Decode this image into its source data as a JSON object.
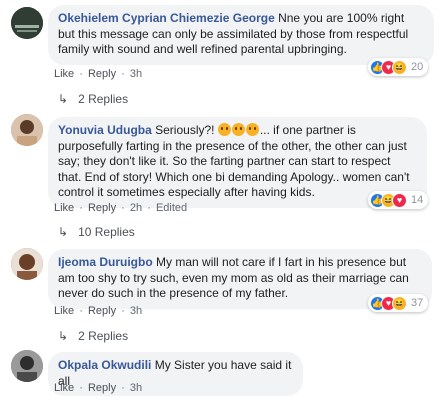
{
  "comments": [
    {
      "author": "Okehielem Cyprian Chiemezie George",
      "text": "Nne you are 100% right but this message can only be assimilated by those from respectful family with sound and well refined parental upbringing.",
      "like": "Like",
      "reply": "Reply",
      "time": "3h",
      "edited": "",
      "reaction_count": "20",
      "replies_label": "2 Replies",
      "avatar_color": "#3a4a3f"
    },
    {
      "author": "Yonuvia Udugba",
      "text_before": "Seriously?!",
      "text_after": "... if one partner is purposefully farting in the presence of the other, the other can just say; they don't like it. So the farting partner can start to respect that. End of story! Which one bi demanding Apology.. women can't control it sometimes especially after having kids.",
      "emoji_names": [
        "worried-face-icon",
        "worried-face-icon",
        "worried-face-icon"
      ],
      "like": "Like",
      "reply": "Reply",
      "time": "2h",
      "edited": "Edited",
      "reaction_count": "14",
      "replies_label": "10 Replies",
      "avatar_color": "#b58e6e"
    },
    {
      "author": "Ijeoma Duruigbo",
      "text": "My man will not care if I fart in his presence but am too shy to try such, even my mom as old as their marriage can never do such in the presence of my father.",
      "like": "Like",
      "reply": "Reply",
      "time": "3h",
      "edited": "",
      "reaction_count": "37",
      "replies_label": "2 Replies",
      "avatar_color": "#8a5a3c"
    },
    {
      "author": "Okpala Okwudili",
      "text": "My Sister you have said it all",
      "like": "Like",
      "reply": "Reply",
      "time": "3h",
      "edited": "",
      "avatar_color": "#6b6b6b"
    }
  ],
  "separator": "·",
  "reply_arrow": "↳",
  "reaction_icons": [
    "like-icon",
    "love-icon",
    "haha-icon"
  ],
  "colors": {
    "author": "#385898",
    "bubble": "#f2f3f5",
    "like_blue": "#1877f2",
    "love_red": "#f0284a",
    "haha_yellow": "#f7b125"
  }
}
